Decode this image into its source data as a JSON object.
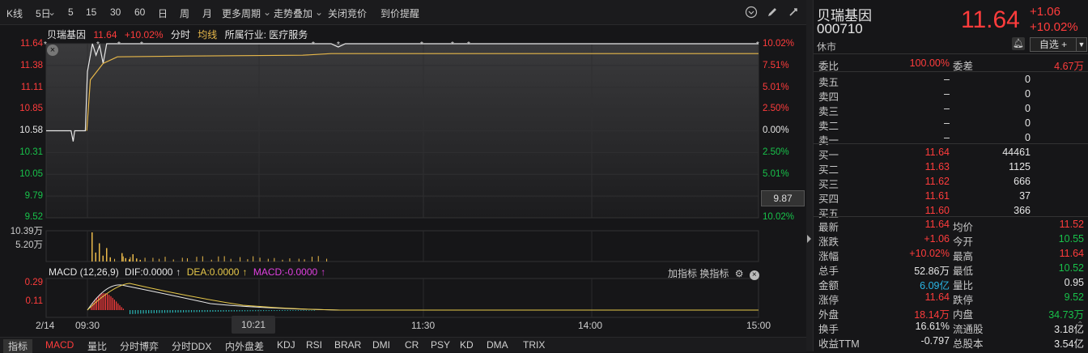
{
  "toolbar": {
    "items": [
      "K线",
      "5日",
      "5",
      "15",
      "30",
      "60",
      "日",
      "周",
      "月",
      "更多周期",
      "走势叠加",
      "关闭竞价",
      "到价提醒"
    ],
    "icons": [
      "clock-icon",
      "pen-icon",
      "settings-icon"
    ]
  },
  "info": {
    "name": "贝瑞基因",
    "price": "11.64",
    "pct": "+10.02%",
    "mode": "分时",
    "avg": "均线",
    "industry": "所属行业: 医疗服务"
  },
  "axis": {
    "left": [
      "11.64",
      "11.38",
      "11.11",
      "10.85",
      "10.58",
      "10.31",
      "10.05",
      "9.79",
      "9.52"
    ],
    "right": [
      "10.02%",
      "7.51%",
      "5.01%",
      "2.50%",
      "0.00%",
      "2.50%",
      "5.01%",
      "7.51%",
      "10.02%"
    ],
    "crosshair_label": "9.87",
    "vol": [
      "10.39万",
      "5.20万"
    ],
    "macd": [
      "0.29",
      "0.11"
    ],
    "x": [
      "2/14",
      "09:30",
      "10:21",
      "11:30",
      "14:00",
      "15:00"
    ]
  },
  "macd": {
    "title": "MACD (12,26,9)",
    "dif": "DIF:0.0000",
    "dea": "DEA:0.0000",
    "macd": "MACD:-0.0000",
    "add_indicator": "加指标",
    "change_indicator": "换指标"
  },
  "bottom_tabs": [
    "指标",
    "MACD",
    "量比",
    "分时博弈",
    "分时DDX",
    "内外盘差",
    "KDJ",
    "RSI",
    "BRAR",
    "DMI",
    "CR",
    "PSY",
    "KD",
    "DMA",
    "TRIX"
  ],
  "chart_data": {
    "type": "line",
    "x_range": [
      "09:30",
      "15:00"
    ],
    "ylim": [
      9.52,
      11.64
    ],
    "prev_close": 10.58,
    "series": [
      {
        "name": "分时",
        "points": [
          [
            0,
            10.58
          ],
          [
            0.035,
            10.58
          ],
          [
            0.038,
            10.45
          ],
          [
            0.04,
            10.58
          ],
          [
            0.055,
            10.58
          ],
          [
            0.058,
            11.3
          ],
          [
            0.065,
            11.64
          ],
          [
            0.07,
            11.5
          ],
          [
            0.075,
            11.62
          ],
          [
            0.08,
            11.4
          ],
          [
            0.085,
            11.64
          ],
          [
            0.4,
            11.64
          ],
          [
            0.41,
            11.6
          ],
          [
            0.42,
            11.64
          ],
          [
            1,
            11.64
          ]
        ]
      },
      {
        "name": "均线",
        "points": [
          [
            0.057,
            10.58
          ],
          [
            0.062,
            11.2
          ],
          [
            0.08,
            11.4
          ],
          [
            0.1,
            11.48
          ],
          [
            0.2,
            11.49
          ],
          [
            0.36,
            11.5
          ],
          [
            0.4,
            11.52
          ],
          [
            1,
            11.52
          ]
        ]
      }
    ],
    "volume": [
      10.39,
      3.2,
      6.5,
      2.1,
      4.8,
      1.5,
      3.0,
      1.2,
      0.8,
      2.6,
      1.1,
      0.6
    ],
    "vol_max": 10.39
  },
  "panel": {
    "name": "贝瑞基因",
    "code": "000710",
    "status": "休市",
    "price": "11.64",
    "change": "+1.06",
    "pct": "+10.02%",
    "watch_btn": "自选 +",
    "weibi_label": "委比",
    "weibi": "100.00%",
    "weicha_label": "委差",
    "weicha": "4.67万",
    "asks": [
      {
        "label": "卖五",
        "price": "–",
        "vol": "0"
      },
      {
        "label": "卖四",
        "price": "–",
        "vol": "0"
      },
      {
        "label": "卖三",
        "price": "–",
        "vol": "0"
      },
      {
        "label": "卖二",
        "price": "–",
        "vol": "0"
      },
      {
        "label": "卖一",
        "price": "–",
        "vol": "0"
      }
    ],
    "bids": [
      {
        "label": "买一",
        "price": "11.64",
        "vol": "44461"
      },
      {
        "label": "买二",
        "price": "11.63",
        "vol": "1125"
      },
      {
        "label": "买三",
        "price": "11.62",
        "vol": "666"
      },
      {
        "label": "买四",
        "price": "11.61",
        "vol": "37"
      },
      {
        "label": "买五",
        "price": "11.60",
        "vol": "366"
      }
    ],
    "stats": [
      {
        "l1": "最新",
        "v1": "11.64",
        "c1": "red",
        "l2": "均价",
        "v2": "11.52",
        "c2": "red"
      },
      {
        "l1": "涨跌",
        "v1": "+1.06",
        "c1": "red",
        "l2": "今开",
        "v2": "10.55",
        "c2": "green"
      },
      {
        "l1": "涨幅",
        "v1": "+10.02%",
        "c1": "red",
        "l2": "最高",
        "v2": "11.64",
        "c2": "red"
      },
      {
        "l1": "总手",
        "v1": "52.86万",
        "c1": "white",
        "l2": "最低",
        "v2": "10.52",
        "c2": "green"
      },
      {
        "l1": "金额",
        "v1": "6.09亿",
        "c1": "cyan",
        "l2": "量比",
        "v2": "0.95",
        "c2": "white"
      },
      {
        "l1": "涨停",
        "v1": "11.64",
        "c1": "red",
        "l2": "跌停",
        "v2": "9.52",
        "c2": "green"
      },
      {
        "l1": "外盘",
        "v1": "18.14万",
        "c1": "red",
        "l2": "内盘",
        "v2": "34.73万",
        "c2": "green"
      },
      {
        "l1": "换手",
        "v1": "16.61%",
        "c1": "white",
        "l2": "流通股",
        "v2": "3.18亿",
        "c2": "white"
      },
      {
        "l1": "收益TTM",
        "v1": "-0.797",
        "c1": "white",
        "l2": "总股本",
        "v2": "3.54亿",
        "c2": "white"
      }
    ]
  }
}
